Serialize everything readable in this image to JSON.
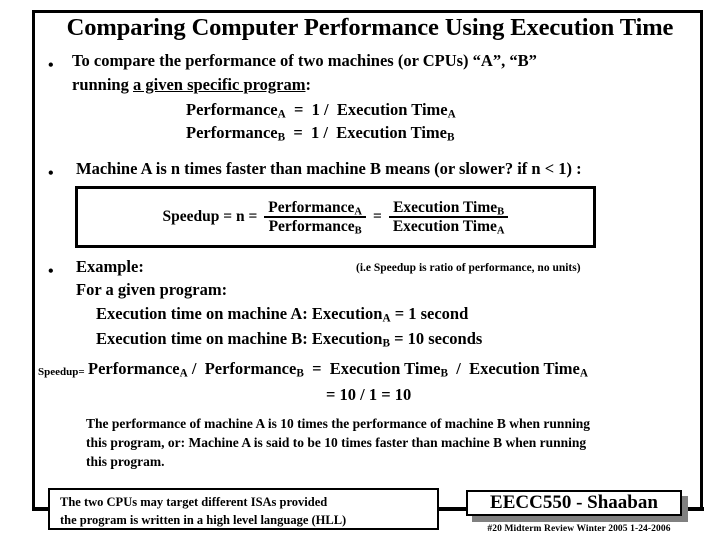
{
  "slide": {
    "title": "Comparing Computer Performance Using Execution Time",
    "bullet_glyph": "•"
  },
  "bullet1": {
    "line1": "To compare the performance of two machines (or CPUs)  “A”, “B”",
    "line2_prefix": "running ",
    "line2_underlined": "a given specific program",
    "line2_suffix": ":",
    "eq1": {
      "lhs": "Performance",
      "lhs_sub": "A",
      "eq": "=",
      "one": "1",
      "slash": "/",
      "rhs": "Execution Time",
      "rhs_sub": "A"
    },
    "eq2": {
      "lhs": "Performance",
      "lhs_sub": "B",
      "eq": "=",
      "one": "1",
      "slash": "/",
      "rhs": "Execution Time",
      "rhs_sub": "B"
    }
  },
  "bullet2": {
    "line1": "Machine A is  n times faster than machine B means  (or slower? if n < 1) :",
    "formula": {
      "label": "Speedup = n =",
      "frac1_num": "Performance",
      "frac1_num_sub": "A",
      "frac1_den": "Performance",
      "frac1_den_sub": "B",
      "equals": "=",
      "frac2_num": "Execution Time",
      "frac2_num_sub": "B",
      "frac2_den": "Execution Time",
      "frac2_den_sub": "A"
    }
  },
  "bullet3": {
    "line1": "Example:",
    "note": "(i.e Speedup is ratio of performance, no units)",
    "line2": "For a given program:",
    "line3_prefix": "Execution time on machine A:   Execution",
    "line3_sub": "A",
    "line3_suffix": " =  1  second",
    "line4_prefix": "Execution time on machine B:  Execution",
    "line4_sub": "B",
    "line4_suffix": " =  10  seconds",
    "calc_label": "Speedup=",
    "calc": {
      "p1": "Performance",
      "p1_sub": "A",
      "slash1": "/",
      "p2": "Performance",
      "p2_sub": "B",
      "equals": "=",
      "e1": "Execution Time",
      "e1_sub": "B",
      "slash2": "/",
      "e2": "Execution Time",
      "e2_sub": "A"
    },
    "result": "=  10 / 1 = 10"
  },
  "explanation": "The performance of machine A  is 10 times the performance of machine B when running this program, or:  Machine A  is said to be 10 times faster than machine B when running this program.",
  "isa_note": {
    "line1": "The two CPUs may target different ISAs  provided",
    "line2": "the program is written in a high level language (HLL)"
  },
  "footer": {
    "course_banner": "EECC550 - Shaaban",
    "meta": "#20   Midterm Review  Winter 2005  1-24-2006"
  },
  "colors": {
    "background": "#ffffff",
    "foreground": "#000000",
    "shadow": "#808080"
  }
}
